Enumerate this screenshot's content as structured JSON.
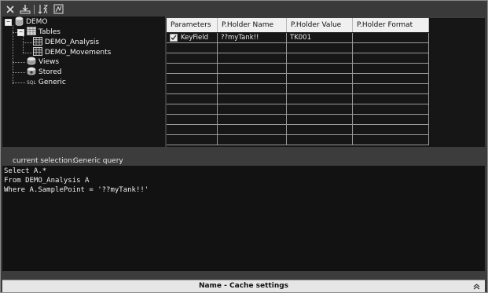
{
  "toolbar": {
    "icons": [
      "close-icon",
      "connect-icon",
      "sort-icon",
      "export-icon"
    ]
  },
  "tree": {
    "root": "DEMO",
    "tables_label": "Tables",
    "tables": [
      "DEMO_Analysis",
      "DEMO_Movements"
    ],
    "views_label": "Views",
    "stored_label": "Stored",
    "generic_label": "Generic",
    "sql_tag": "SQL"
  },
  "grid": {
    "columns": [
      "Parameters",
      "P.Holder Name",
      "P.Holder Value",
      "P.Holder Format"
    ],
    "rows": [
      {
        "checked": true,
        "parameter": "KeyField",
        "name": "??myTank!!",
        "value": "TK001",
        "format": ""
      }
    ]
  },
  "selection": {
    "label": "current selection:",
    "value": "Generic query"
  },
  "query": {
    "lines": [
      "Select A.*",
      "From DEMO_Analysis A",
      "Where A.SamplePoint = '??myTank!!'"
    ]
  },
  "cache": {
    "title": "Name - Cache settings"
  }
}
